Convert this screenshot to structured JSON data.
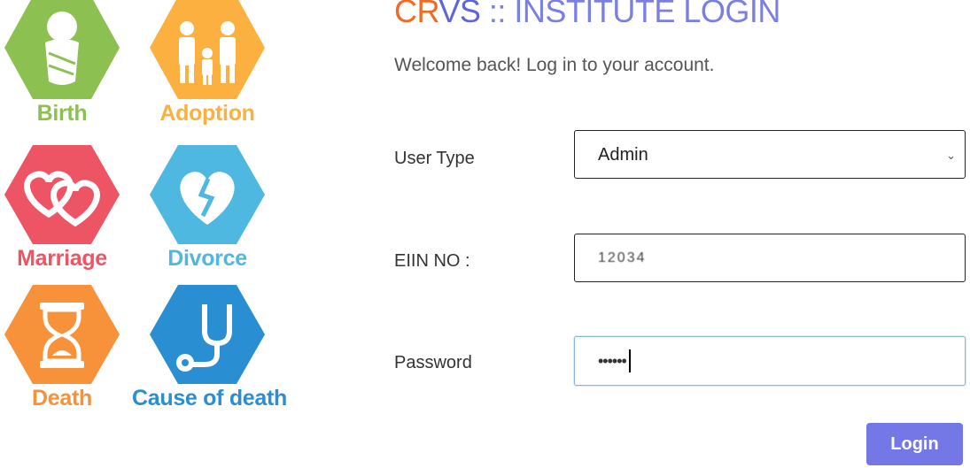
{
  "categories": [
    {
      "label": "Birth",
      "color": "#8cc152",
      "text_color": "#8cc152"
    },
    {
      "label": "Adoption",
      "color": "#fbb040",
      "text_color": "#fbb040"
    },
    {
      "label": "Marriage",
      "color": "#ed5565",
      "text_color": "#ed5565"
    },
    {
      "label": "Divorce",
      "color": "#4fb8e0",
      "text_color": "#4fb8e0"
    },
    {
      "label": "Death",
      "color": "#f7923a",
      "text_color": "#f7923a"
    },
    {
      "label": "Cause of death",
      "color": "#2a8fd2",
      "text_color": "#2a8fd2"
    }
  ],
  "header": {
    "title_cr": "CR",
    "title_vs": "VS",
    "title_rest": " :: INSTITUTE LOGIN",
    "welcome": "Welcome back! Log in to your account."
  },
  "form": {
    "user_type_label": "User Type",
    "user_type_value": "Admin",
    "eiin_label": "EIIN NO :",
    "eiin_value": "12034",
    "password_label": "Password",
    "password_value": "••••••",
    "login_label": "Login"
  }
}
